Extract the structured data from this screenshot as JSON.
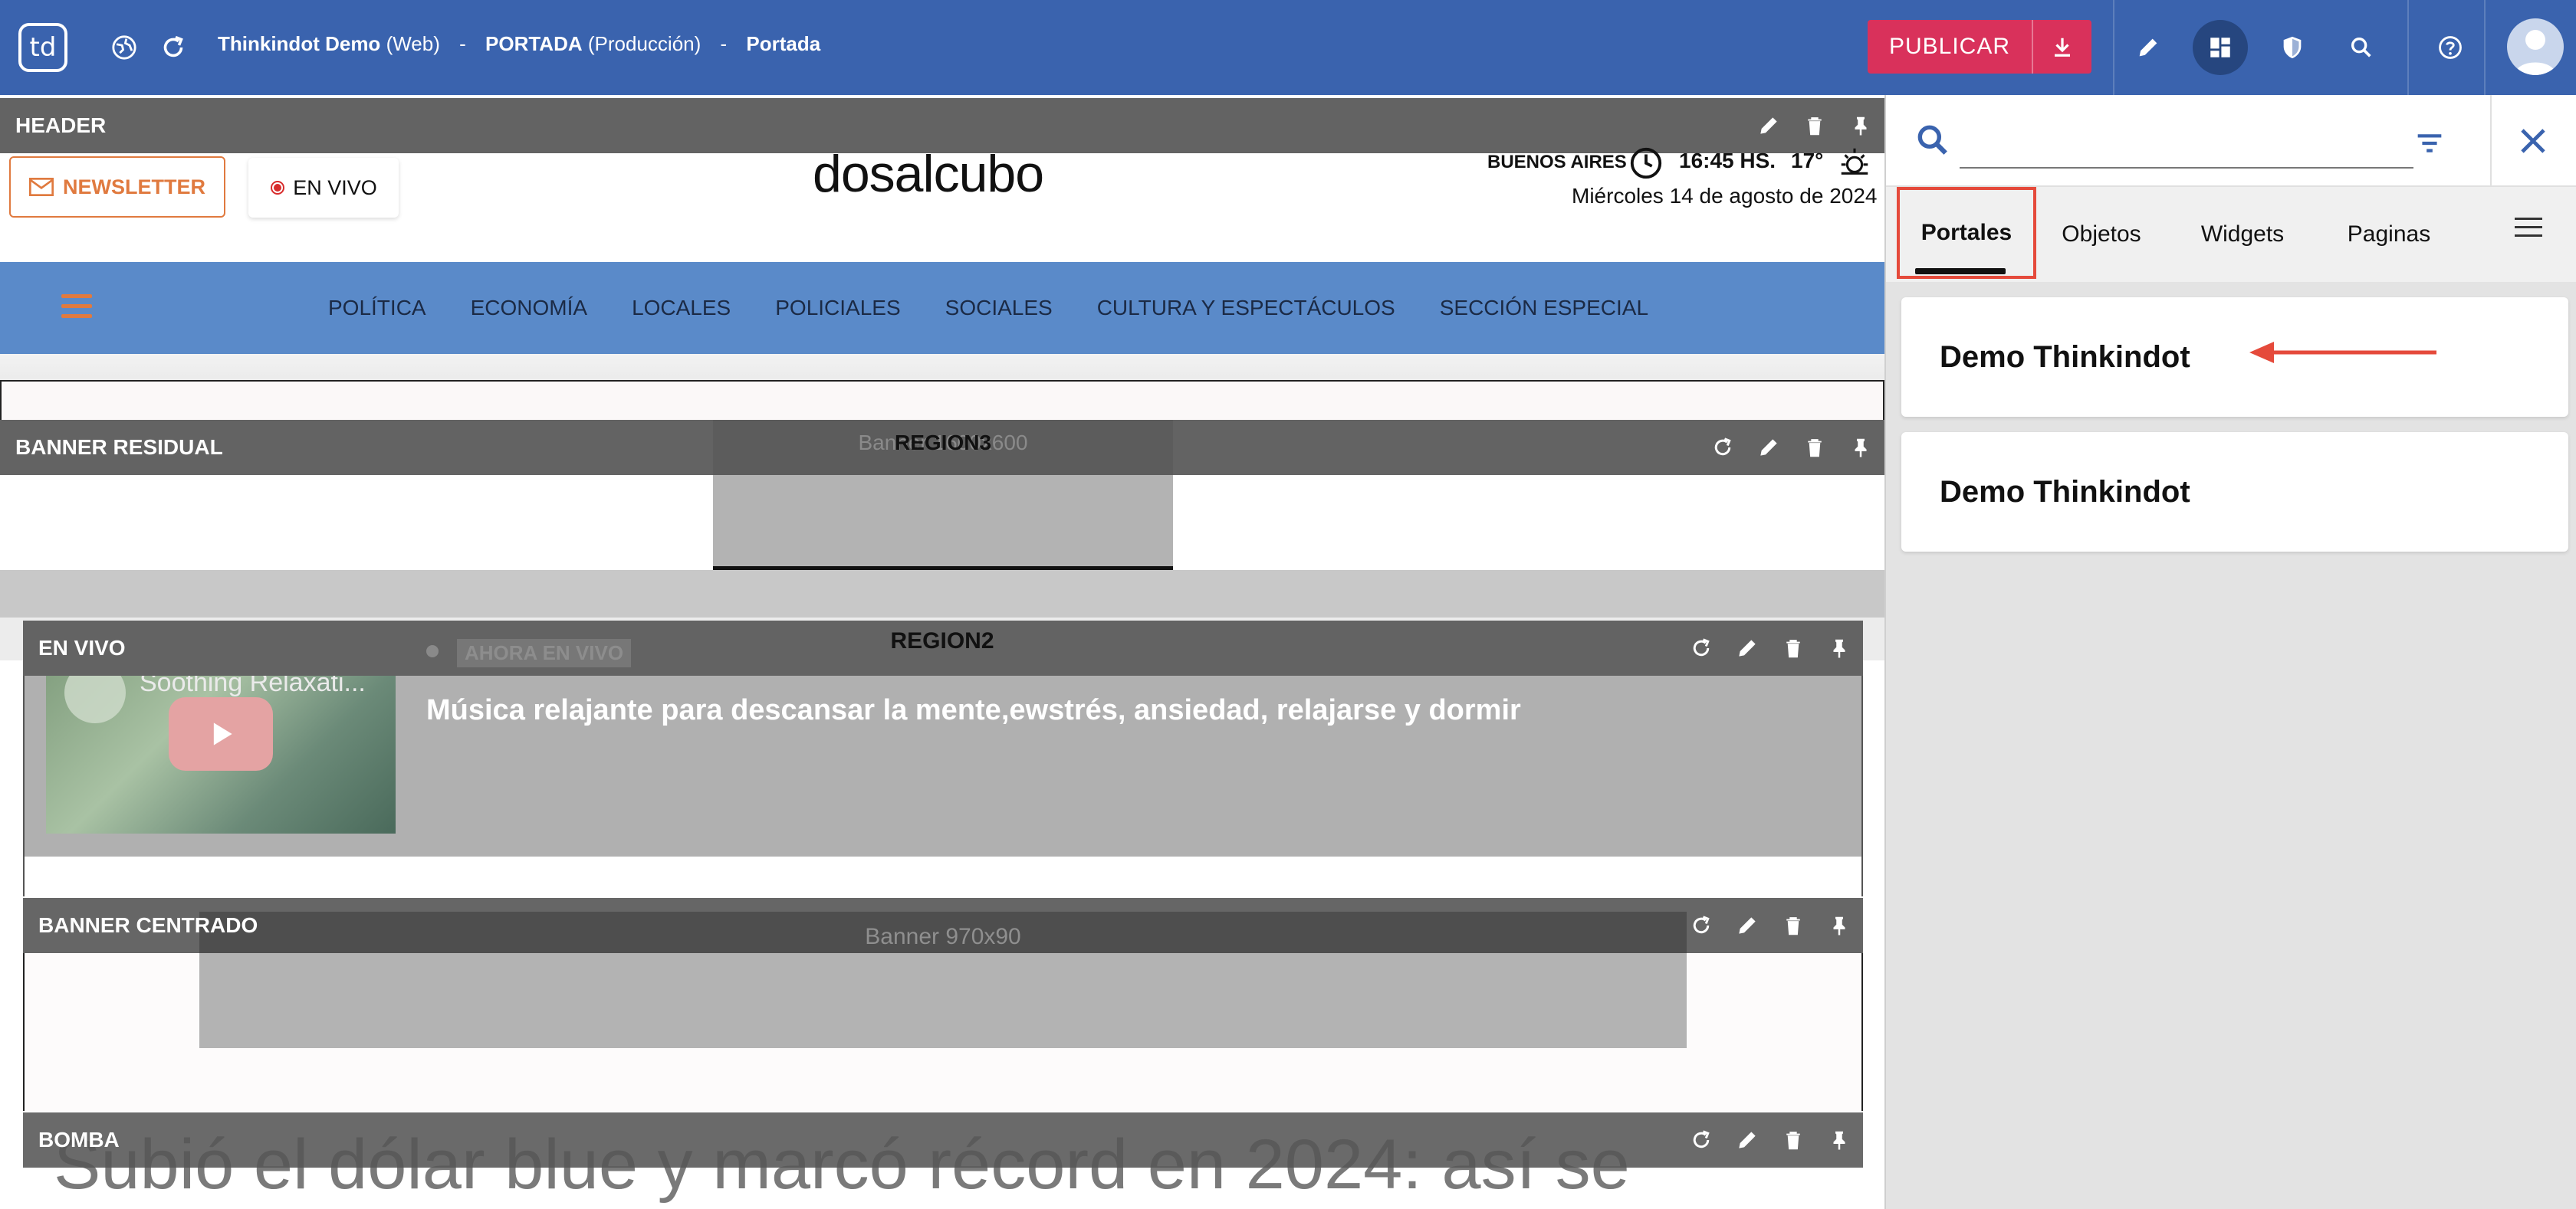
{
  "topbar": {
    "logo": "td",
    "breadcrumb": {
      "site_name": "Thinkindot Demo",
      "site_type": "(Web)",
      "sep": "-",
      "page_name": "PORTADA",
      "page_env": "(Producción)",
      "current": "Portada"
    },
    "publish_label": "PUBLICAR",
    "icons": [
      "globe-icon",
      "refresh-icon",
      "download-icon",
      "pencil-icon",
      "layout-icon",
      "shield-icon",
      "search-icon",
      "help-icon",
      "avatar"
    ]
  },
  "header": {
    "section_label": "HEADER",
    "newsletter_label": "NEWSLETTER",
    "envivo_label": "EN VIVO",
    "brand_left": "dos",
    "brand_mid": "al",
    "brand_right": "cubo",
    "city": "BUENOS AIRES",
    "time": "16:45 HS.",
    "temp": "17°",
    "date": "Miércoles 14 de agosto de 2024"
  },
  "nav": {
    "items": [
      "POLÍTICA",
      "ECONOMÍA",
      "LOCALES",
      "POLICIALES",
      "SOCIALES",
      "CULTURA Y ESPECTÁCULOS",
      "SECCIÓN ESPECIAL"
    ]
  },
  "sections": {
    "banner_residual": "BANNER RESIDUAL",
    "banner_600_label": "Banner 1600x600",
    "region3": "REGION3",
    "region2": "REGION2",
    "en_vivo": "EN VIVO",
    "banner_centrado": "BANNER CENTRADO",
    "banner_970_label": "Banner 970x90",
    "bomba": "BOMBA"
  },
  "envivo": {
    "video_title": "Soothing Relaxati...",
    "live_badge": "AHORA EN VIVO",
    "headline": "Música relajante para descansar la mente,ewstrés, ansiedad, relajarse y dormir"
  },
  "bomba": {
    "headline": "Subió el dólar blue y marcó récord en 2024: así se"
  },
  "panel": {
    "search_value": "",
    "tabs": [
      "Portales",
      "Objetos",
      "Widgets",
      "Paginas"
    ],
    "active_tab": "Portales",
    "cards": [
      "Demo Thinkindot",
      "Demo Thinkindot"
    ]
  },
  "colors": {
    "topbar": "#3a63ae",
    "publish": "#d9315b",
    "nav": "#5a8ac9",
    "accent_orange": "#e07a3f",
    "highlight_red": "#e54a3b"
  }
}
